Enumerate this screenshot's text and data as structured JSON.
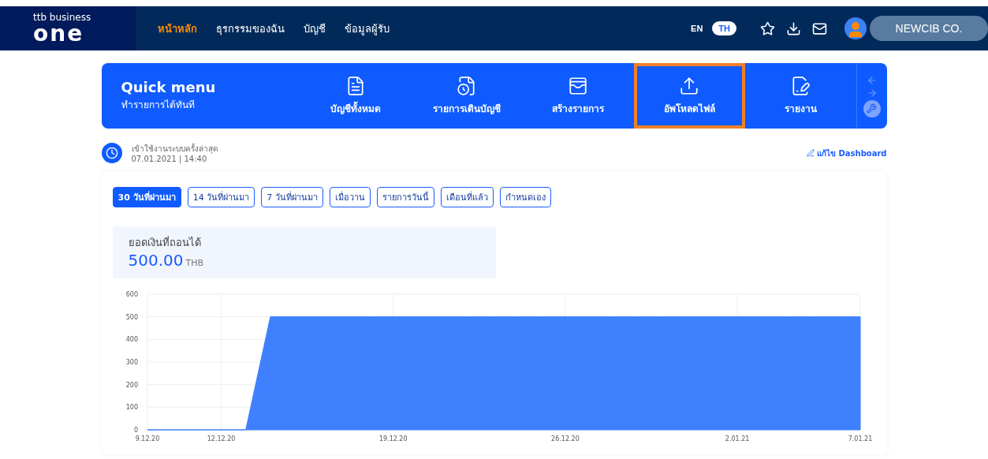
{
  "header": {
    "logo": {
      "brand": "ttb business",
      "product": "one"
    },
    "nav": [
      {
        "label": "หน้าหลัก",
        "selected": true
      },
      {
        "label": "ธุรกรรมของฉัน",
        "selected": false
      },
      {
        "label": "บัญชี",
        "selected": false
      },
      {
        "label": "ข้อมูลผู้รับ",
        "selected": false
      }
    ],
    "languages": [
      {
        "label": "EN",
        "selected": false
      },
      {
        "label": "TH",
        "selected": true
      }
    ],
    "company": "NEWCIB CO."
  },
  "quick_menu": {
    "title": "Quick menu",
    "subtitle": "ทำรายการได้ทันที",
    "items": [
      {
        "label": "บัญชีทั้งหมด",
        "kind": "accounts",
        "highlighted": false
      },
      {
        "label": "รายการเดินบัญชี",
        "kind": "statement",
        "highlighted": false
      },
      {
        "label": "สร้างรายการ",
        "kind": "create",
        "highlighted": false
      },
      {
        "label": "อัพโหลดไฟล์",
        "kind": "upload",
        "highlighted": true
      },
      {
        "label": "รายงาน",
        "kind": "report",
        "highlighted": false
      }
    ]
  },
  "last_login": {
    "label": "เข้าใช้งานระบบครั้งล่าสุด",
    "value": "07.01.2021 | 14:40"
  },
  "edit_dashboard": "แก้ไข Dashboard",
  "periods": [
    {
      "label": "30 วันที่ผ่านมา",
      "selected": true
    },
    {
      "label": "14 วันที่ผ่านมา",
      "selected": false
    },
    {
      "label": "7 วันที่ผ่านมา",
      "selected": false
    },
    {
      "label": "เมื่อวาน",
      "selected": false
    },
    {
      "label": "รายการวันนี้",
      "selected": false
    },
    {
      "label": "เดือนที่แล้ว",
      "selected": false
    },
    {
      "label": "กำหนดเอง",
      "selected": false
    }
  ],
  "balance": {
    "label": "ยอดเงินที่ถอนได้",
    "amount": "500.00",
    "currency": "THB"
  },
  "chart_data": {
    "type": "area",
    "categories": [
      "9.12.20",
      null,
      null,
      "12.12.20",
      null,
      null,
      null,
      null,
      null,
      null,
      "19.12.20",
      null,
      null,
      null,
      null,
      null,
      null,
      "26.12.20",
      null,
      null,
      null,
      null,
      null,
      null,
      "2.01.21",
      null,
      null,
      null,
      null,
      "7.01.21"
    ],
    "series": [
      {
        "color": "#3f80ff",
        "values": [
          0,
          0,
          0,
          0,
          0,
          500,
          500,
          500,
          500,
          500,
          500,
          500,
          500,
          500,
          500,
          500,
          500,
          500,
          500,
          500,
          500,
          500,
          500,
          500,
          500,
          500,
          500,
          500,
          500,
          500
        ]
      }
    ],
    "ylim": [
      0,
      600
    ],
    "grid": true,
    "yticks": [
      0,
      100,
      200,
      300,
      400,
      500,
      600
    ]
  }
}
